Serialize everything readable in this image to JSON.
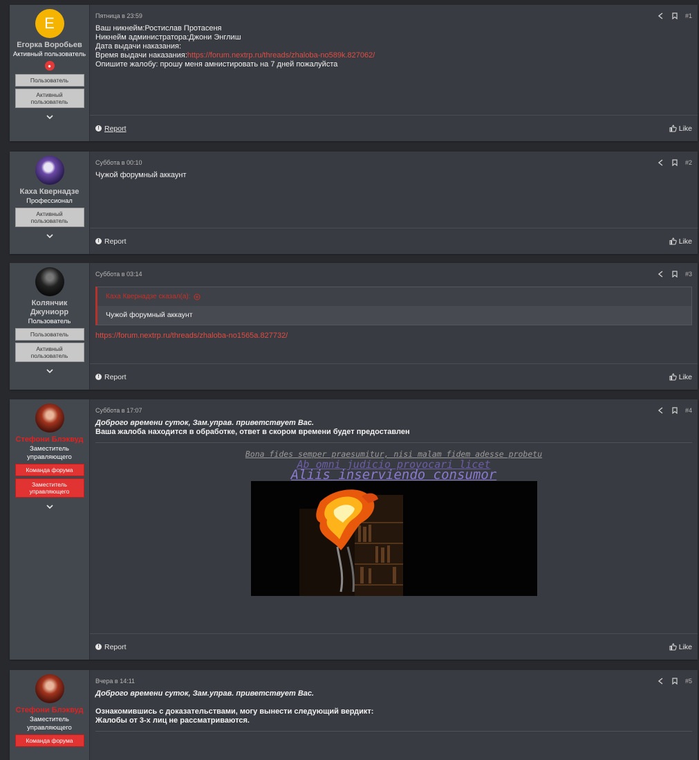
{
  "posts": [
    {
      "author": {
        "name": "Егорка Воробьев",
        "title": "Активный пользователь",
        "avatar_letter": "E",
        "banners": [
          "Пользователь",
          "Активный пользователь"
        ]
      },
      "date": "Пятница в 23:59",
      "number": "#1",
      "lines": [
        "Ваш никнейм:Ростислав Протасеня",
        "Никнейм администратора:Джони Энглиш",
        "Дата выдачи наказания:"
      ],
      "time_label": "Время выдачи наказания:",
      "time_link": "https://forum.nextrp.ru/threads/zhaloba-no589k.827062/",
      "last_line": "Опишите жалобу: прошу меня амнистировать на 7 дней пожалуйста"
    },
    {
      "author": {
        "name": "Каха Квернадзе",
        "title": "Профессионал",
        "banners": [
          "Активный пользователь"
        ]
      },
      "date": "Суббота в 00:10",
      "number": "#2",
      "text": "Чужой форумный аккаунт"
    },
    {
      "author": {
        "name": "Колянчик Джуниорр",
        "title": "Пользователь",
        "banners": [
          "Пользователь",
          "Активный пользователь"
        ]
      },
      "date": "Суббота в 03:14",
      "number": "#3",
      "quote_head": "Каха Квернадзе сказал(а):",
      "quote_body": "Чужой форумный аккаунт",
      "link": "https://forum.nextrp.ru/threads/zhaloba-no1565a.827732/"
    },
    {
      "author": {
        "name": "Стефони Блэквуд",
        "title": "Заместитель управляющего",
        "banners": [
          "Команда форума",
          "Заместитель управляющего"
        ]
      },
      "date": "Суббота в 17:07",
      "number": "#4",
      "greeting": "Доброго времени суток, Зам.управ. приветствует Вас.",
      "text": "Ваша жалоба находится в обработке, ответ в скором времени будет предоставлен",
      "motto1": "Bona fides semper praesumitur, nisi malam fidem adesse probetu",
      "motto2": "Ab omni judicio provocari licet",
      "motto3": "Aliis inserviendo consumor"
    },
    {
      "author": {
        "name": "Стефони Блэквуд",
        "title": "Заместитель управляющего",
        "banners": [
          "Команда форума"
        ]
      },
      "date": "Вчера в 14:11",
      "number": "#5",
      "greeting": "Доброго времени суток, Зам.управ. приветствует Вас.",
      "line1": "Ознакомившись с доказательствами, могу вынести следующий вердикт:",
      "line2": "Жалобы от 3-х лиц не рассматриваются."
    }
  ],
  "footer": {
    "report": "Report",
    "like": "Like"
  },
  "icons": {
    "share": "share-icon",
    "bookmark": "bookmark-icon",
    "expand": "chevron-down-icon",
    "info": "info-icon",
    "like": "thumbs-up-icon"
  },
  "colors": {
    "link": "#e14d44",
    "staff_name": "#e02222",
    "staff_banner": "#e23333"
  }
}
